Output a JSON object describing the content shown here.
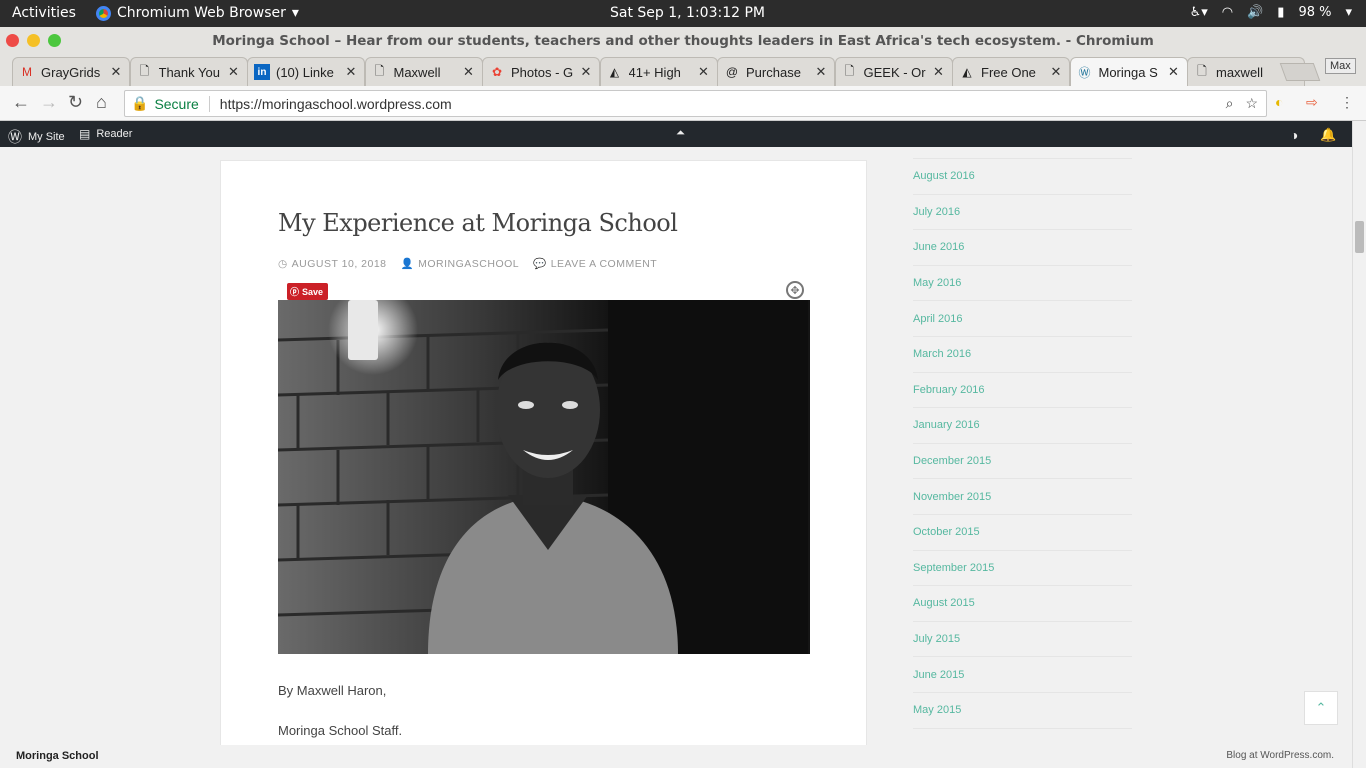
{
  "system": {
    "activities": "Activities",
    "app_name": "Chromium Web Browser",
    "clock": "Sat Sep  1,  1:03:12 PM",
    "battery": "98 %"
  },
  "window": {
    "title": "Moringa School – Hear from our students, teachers and other thoughts leaders in East Africa's tech ecosystem. - Chromium"
  },
  "tabs": [
    {
      "label": "GrayGrids",
      "icon": "gmail-icon"
    },
    {
      "label": "Thank You",
      "icon": "page-icon"
    },
    {
      "label": "(10) Linke",
      "icon": "linkedin-icon"
    },
    {
      "label": "Maxwell",
      "icon": "page-icon"
    },
    {
      "label": "Photos - G",
      "icon": "photos-icon"
    },
    {
      "label": "41+ High",
      "icon": "spartan-icon"
    },
    {
      "label": "Purchase",
      "icon": "at-icon"
    },
    {
      "label": "GEEK - Or",
      "icon": "page-icon"
    },
    {
      "label": "Free One",
      "icon": "spartan-icon"
    },
    {
      "label": "Moringa S",
      "icon": "wordpress-icon",
      "active": true
    },
    {
      "label": "maxwell",
      "icon": "page-icon"
    }
  ],
  "max_label": "Max",
  "omnibox": {
    "secure": "Secure",
    "url": "https://moringaschool.wordpress.com"
  },
  "wpbar": {
    "my_site": "My Site",
    "reader": "Reader"
  },
  "post": {
    "title": "My Experience at Moringa School",
    "date": "AUGUST 10, 2018",
    "author": "MORINGASCHOOL",
    "comment": "LEAVE A COMMENT",
    "save": "Save",
    "byline": "By Maxwell Haron,",
    "staff": "Moringa School Staff."
  },
  "archives": [
    "August 2016",
    "July 2016",
    "June 2016",
    "May 2016",
    "April 2016",
    "March 2016",
    "February 2016",
    "January 2016",
    "December 2015",
    "November 2015",
    "October 2015",
    "September 2015",
    "August 2015",
    "July 2015",
    "June 2015",
    "May 2015"
  ],
  "footer": {
    "site": "Moringa School",
    "credit": "Blog at WordPress.com."
  },
  "colors": {
    "accent": "#56b8a0",
    "wpbar": "#23282d",
    "pinterest": "#cb2027",
    "secure": "#0b8043"
  }
}
